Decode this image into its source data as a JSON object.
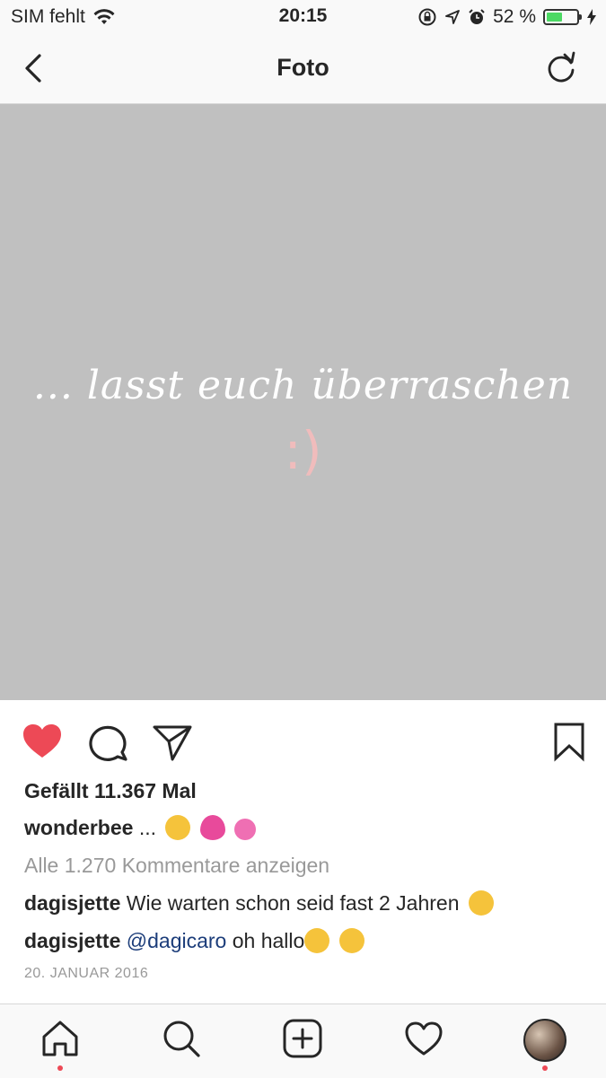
{
  "status_bar": {
    "carrier": "SIM fehlt",
    "time": "20:15",
    "battery_percent_label": "52 %",
    "battery_level": 0.52
  },
  "nav": {
    "title": "Foto"
  },
  "photo": {
    "caption": "... lasst euch überraschen",
    "smiley": ":)"
  },
  "post": {
    "likes": "Gefällt 11.367 Mal",
    "author": "wonderbee",
    "author_caption": "...",
    "view_comments": "Alle 1.270 Kommentare anzeigen",
    "comments": [
      {
        "user": "dagisjette",
        "text": "Wie warten schon seid fast 2 Jahren"
      },
      {
        "user": "dagisjette",
        "mention": "@dagicaro",
        "text": "oh hallo"
      }
    ],
    "date": "20. JANUAR 2016"
  },
  "colors": {
    "like_red": "#ed4956",
    "photo_bg": "#c0c0c0",
    "mention_blue": "#1c3d7a",
    "battery_green": "#4cd964"
  },
  "icons": [
    "wifi-icon",
    "lock-rotation-icon",
    "location-icon",
    "alarm-icon",
    "charging-icon",
    "back-chevron-icon",
    "reload-icon",
    "heart-filled-icon",
    "comment-icon",
    "share-icon",
    "bookmark-icon",
    "home-icon",
    "search-icon",
    "add-icon",
    "activity-heart-icon",
    "profile-avatar"
  ]
}
